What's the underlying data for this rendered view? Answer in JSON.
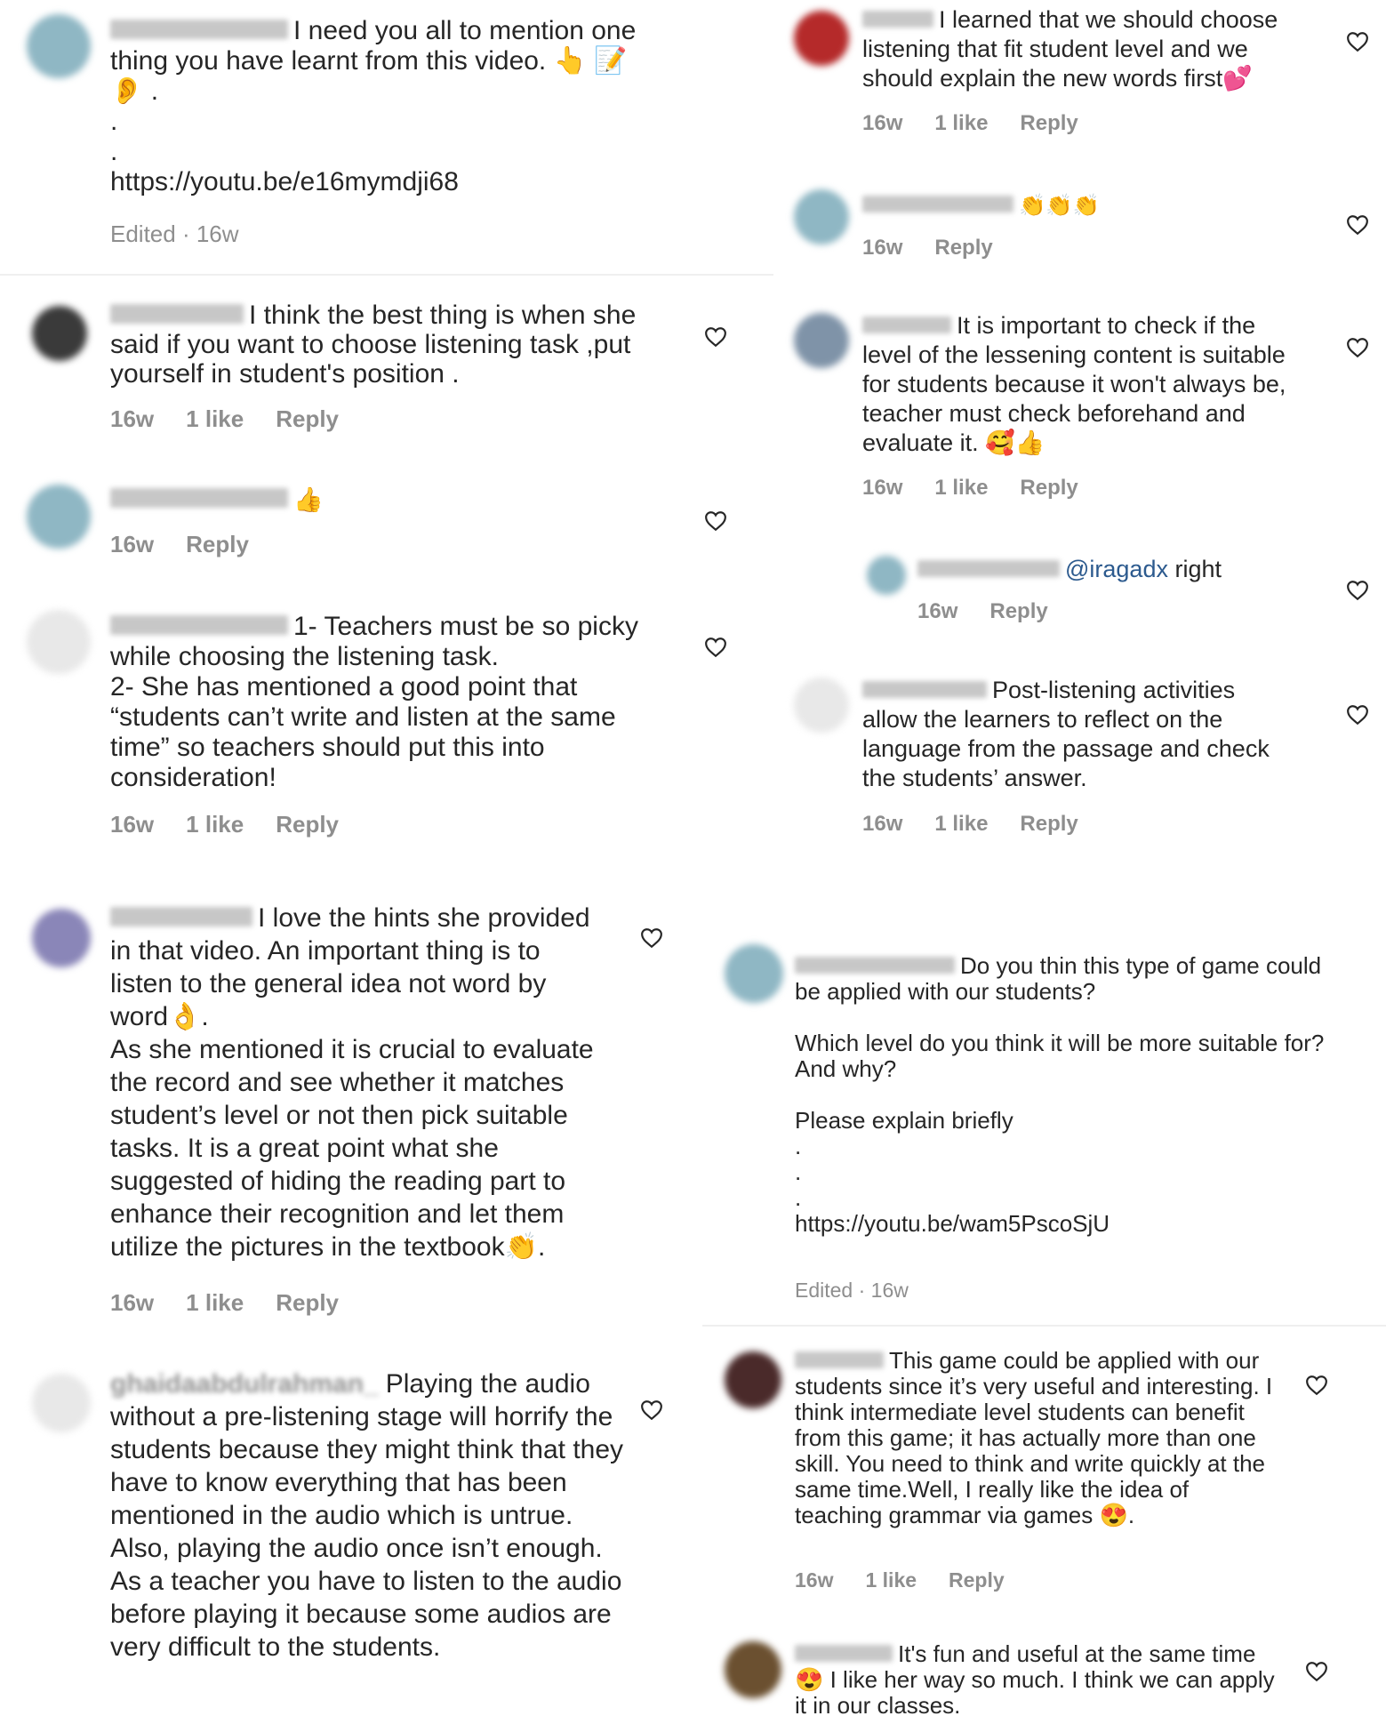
{
  "left": {
    "post": {
      "text": "I need you all to mention one thing you have learnt from this video. 👆 📝\n👂 .\n.\n.\nhttps://youtu.be/e16mymdji68",
      "meta": "Edited · 16w"
    },
    "comments": [
      {
        "text": "I think the best thing is when she said if you want to choose listening task ,put yourself in student's position .",
        "time": "16w",
        "likes": "1 like",
        "reply": "Reply"
      },
      {
        "text": "👍",
        "time": "16w",
        "reply": "Reply"
      },
      {
        "text": "1- Teachers must be so picky while choosing the listening task.\n2- She has mentioned a good point that “students can’t write and listen at the same time” so teachers should put this into consideration!",
        "time": "16w",
        "likes": "1 like",
        "reply": "Reply"
      },
      {
        "text": "I love the hints she provided in that video. An important thing is to listen to the general idea not word by word👌.\nAs she mentioned it is crucial to evaluate the record and see whether it matches student’s level or not then pick suitable tasks. It is a great point what she suggested of hiding the reading part to enhance their recognition and let them utilize the pictures in the textbook👏.",
        "time": "16w",
        "likes": "1 like",
        "reply": "Reply"
      },
      {
        "name": "ghaidaabdulrahman_",
        "text": "Playing the audio without a pre-listening stage will horrify the students because they might think that they have to know everything  that has been mentioned in the audio which is untrue. Also, playing the audio once isn’t enough. As a teacher you have to listen to the audio before playing it because some audios are very difficult to the students."
      }
    ]
  },
  "right": {
    "comments": [
      {
        "text": "I learned that we should choose listening that fit student level and we should explain the new words first💕",
        "time": "16w",
        "likes": "1 like",
        "reply": "Reply"
      },
      {
        "text": "👏👏👏",
        "time": "16w",
        "reply": "Reply"
      },
      {
        "text": "It is important to check if the level of the lessening content is suitable for students because it won't always be, teacher must check beforehand and evaluate it. 🥰👍",
        "time": "16w",
        "likes": "1 like",
        "reply": "Reply"
      },
      {
        "mention": "@iragadx",
        "text": " right",
        "time": "16w",
        "reply": "Reply"
      },
      {
        "text": "Post-listening activities allow the learners to reflect on the language from the passage and check the students’ answer.",
        "time": "16w",
        "likes": "1 like",
        "reply": "Reply"
      }
    ],
    "post": {
      "text": "Do you thin this type of game could be applied with our students?\n\nWhich level do you think it will be more suitable for? And why?\n\nPlease explain briefly\n.\n.\n.\nhttps://youtu.be/wam5PscoSjU",
      "meta": "Edited · 16w"
    },
    "post_comments": [
      {
        "text": "This game could be applied with our students since it’s very useful and interesting. I think intermediate level students can benefit from this game; it has actually more than one skill. You need to think and write quickly at the same time.Well, I really like the idea of teaching grammar via games 😍.",
        "time": "16w",
        "likes": "1 like",
        "reply": "Reply"
      },
      {
        "text": "It's fun and useful at the same time😍 I like her way so much. I think we can apply it in our classes."
      }
    ]
  },
  "colors": {
    "text": "#262626",
    "meta": "#8e8e8e",
    "mention": "#2c5a8e",
    "divider": "#efefef"
  }
}
